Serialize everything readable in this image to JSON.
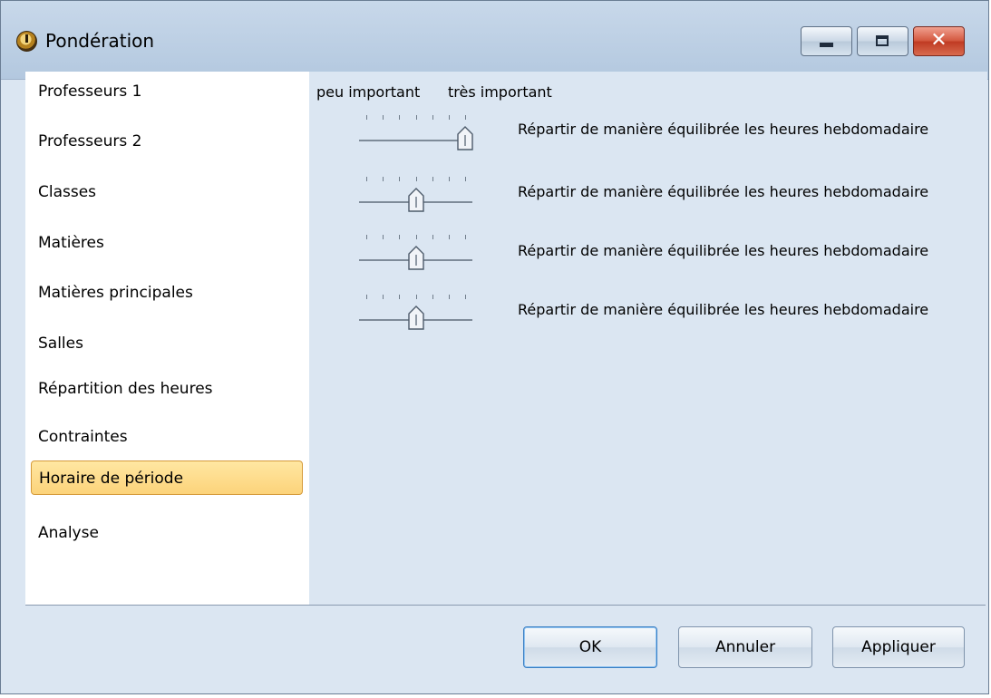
{
  "window": {
    "title": "Pondération",
    "icon": "clock-icon",
    "controls": [
      "minimize-icon",
      "maximize-icon",
      "close-icon"
    ]
  },
  "sidebar": {
    "items": [
      {
        "label": "Professeurs 1"
      },
      {
        "label": "Professeurs 2"
      },
      {
        "label": "Classes"
      },
      {
        "label": "Matières"
      },
      {
        "label": "Matières principales"
      },
      {
        "label": "Salles"
      },
      {
        "label": "Répartition des heures"
      },
      {
        "label": "Contraintes"
      },
      {
        "label": "Horaire de période"
      },
      {
        "label": "Analyse"
      }
    ],
    "selected_index": 8,
    "selected_color": "#fcd37a"
  },
  "scale": {
    "low_label": "peu important",
    "high_label": "très important"
  },
  "rows": [
    {
      "label": "Répartir de manière équilibrée les heures hebdomadaire",
      "level": 1.0
    },
    {
      "label": "Répartir de manière équilibrée les heures hebdomadaire",
      "level": 0.5
    },
    {
      "label": "Répartir de manière équilibrée les heures hebdomadaire",
      "level": 0.5
    },
    {
      "label": "Répartir de manière équilibrée les heures hebdomadaire",
      "level": 0.5
    }
  ],
  "buttons": {
    "ok": "OK",
    "cancel": "Annuler",
    "apply": "Appliquer"
  }
}
